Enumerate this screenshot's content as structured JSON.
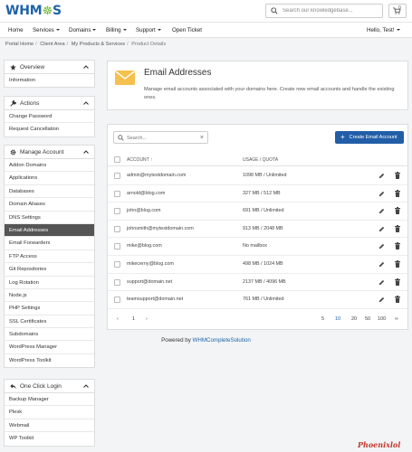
{
  "brand": {
    "logo_text": "WHM",
    "logo_cog": "☸",
    "logo_tail": "S"
  },
  "search": {
    "placeholder": "Search our knowledgebase..."
  },
  "cart": {
    "count": "0"
  },
  "nav": {
    "items": [
      "Home",
      "Services",
      "Domains",
      "Billing",
      "Support",
      "Open Ticket"
    ],
    "user": "Hello, Test!"
  },
  "breadcrumb": [
    "Portal Home",
    "Client Area",
    "My Products & Services",
    "Product Details"
  ],
  "sidebar": {
    "overview": {
      "title": "Overview",
      "items": [
        "Information"
      ]
    },
    "actions": {
      "title": "Actions",
      "items": [
        "Change Password",
        "Request Cancellation"
      ]
    },
    "manage": {
      "title": "Manage Account",
      "items": [
        "Addon Domains",
        "Applications",
        "Databases",
        "Domain Aliases",
        "DNS Settings",
        "Email Addresses",
        "Email Forwarders",
        "FTP Access",
        "Git Repositories",
        "Log Rotation",
        "Node.js",
        "PHP Settings",
        "SSL Certificates",
        "Subdomains",
        "WordPress Manager",
        "WordPress Toolkit"
      ],
      "active": "Email Addresses"
    },
    "oneclick": {
      "title": "One Click Login",
      "items": [
        "Backup Manager",
        "Plesk",
        "Webmail",
        "WP Toolkit"
      ]
    }
  },
  "page": {
    "title": "Email Addresses",
    "description": "Manage email accounts associated with your domains here. Create new email accounts and handle the existing ones."
  },
  "table": {
    "search_placeholder": "Search...",
    "create_label": "Create Email Account",
    "col_account": "ACCOUNT",
    "col_usage": "USAGE / QUOTA",
    "rows": [
      {
        "account": "admin@mytestdomain.com",
        "usage": "1098 MB / Unlimited"
      },
      {
        "account": "arnold@blog.com",
        "usage": "327 MB / 512 MB"
      },
      {
        "account": "john@blog.com",
        "usage": "691 MB / Unlimited"
      },
      {
        "account": "johnsmith@mytestdomain.com",
        "usage": "913 MB / 2048 MB"
      },
      {
        "account": "mike@blog.com",
        "usage": "No mailbox"
      },
      {
        "account": "mikecerny@blog.com",
        "usage": "498 MB / 1024 MB"
      },
      {
        "account": "support@domain.net",
        "usage": "2137 MB / 4096 MB"
      },
      {
        "account": "teamsupport@domain.net",
        "usage": "761 MB / Unlimited"
      }
    ],
    "pager": {
      "prev": "‹",
      "page": "1",
      "next": "›",
      "sizes": [
        "5",
        "10",
        "20",
        "50",
        "100",
        "∞"
      ],
      "current_size": "10"
    }
  },
  "footer": {
    "powered_by": "Powered by",
    "powered_link": "WHMCompleteSolution"
  },
  "watermark": "Phoenixlol",
  "colors": {
    "accent": "#225ea8",
    "logo_blue": "#1e63a8",
    "logo_green": "#6fb63b",
    "active_item": "#555555"
  }
}
